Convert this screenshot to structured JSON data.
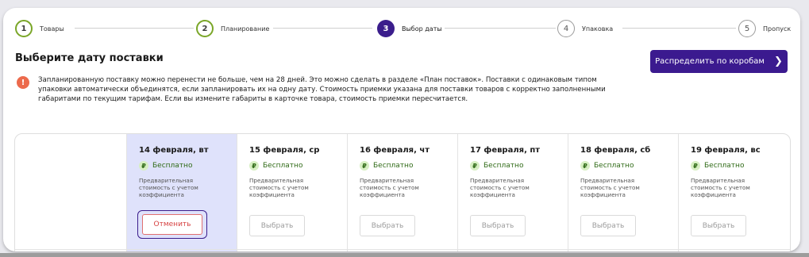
{
  "stepper": {
    "steps": [
      {
        "number": "1",
        "label": "Товары",
        "state": "done"
      },
      {
        "number": "2",
        "label": "Планирование",
        "state": "done"
      },
      {
        "number": "3",
        "label": "Выбор даты",
        "state": "active"
      },
      {
        "number": "4",
        "label": "Упаковка",
        "state": "pending"
      },
      {
        "number": "5",
        "label": "Пропуск",
        "state": "pending"
      }
    ]
  },
  "page": {
    "title": "Выберите дату поставки",
    "primary_button": "Распределить по коробам",
    "primary_button_icon": "chevron-right-icon"
  },
  "notice": {
    "icon": "!",
    "text": "Запланированную поставку можно перенести не больше, чем на 28 дней. Это можно сделать в разделе «План поставок». Поставки с одинаковым типом упаковки автоматически объединятся, если запланировать их на одну дату. Стоимость приемки указана для поставки товаров с корректно заполненными габаритами по текущим тарифам. Если вы измените габариты в карточке товара, стоимость приемки пересчитается."
  },
  "calendar": {
    "currency_symbol": "₽",
    "days": [
      {
        "date": "14 февраля, вт",
        "price": "Бесплатно",
        "description": "Предварительная стоимость с учетом коэффициента",
        "action": "Отменить",
        "selected": true
      },
      {
        "date": "15 февраля, ср",
        "price": "Бесплатно",
        "description": "Предварительная стоимость с учетом коэффициента",
        "action": "Выбрать",
        "selected": false
      },
      {
        "date": "16 февраля, чт",
        "price": "Бесплатно",
        "description": "Предварительная стоимость с учетом коэффициента",
        "action": "Выбрать",
        "selected": false
      },
      {
        "date": "17 февраля, пт",
        "price": "Бесплатно",
        "description": "Предварительная стоимость с учетом коэффициента",
        "action": "Выбрать",
        "selected": false
      },
      {
        "date": "18 февраля, сб",
        "price": "Бесплатно",
        "description": "Предварительная стоимость с учетом коэффициента",
        "action": "Выбрать",
        "selected": false
      },
      {
        "date": "19 февраля, вс",
        "price": "Бесплатно",
        "description": "Предварительная стоимость с учетом коэффициента",
        "action": "Выбрать",
        "selected": false
      }
    ]
  },
  "colors": {
    "accent": "#3b1a8f",
    "done": "#7aa628",
    "selected_bg": "#dfe2fb",
    "free_green": "#2f6a16",
    "cancel_red": "#d64040",
    "notice_orange": "#ec6a4c"
  }
}
